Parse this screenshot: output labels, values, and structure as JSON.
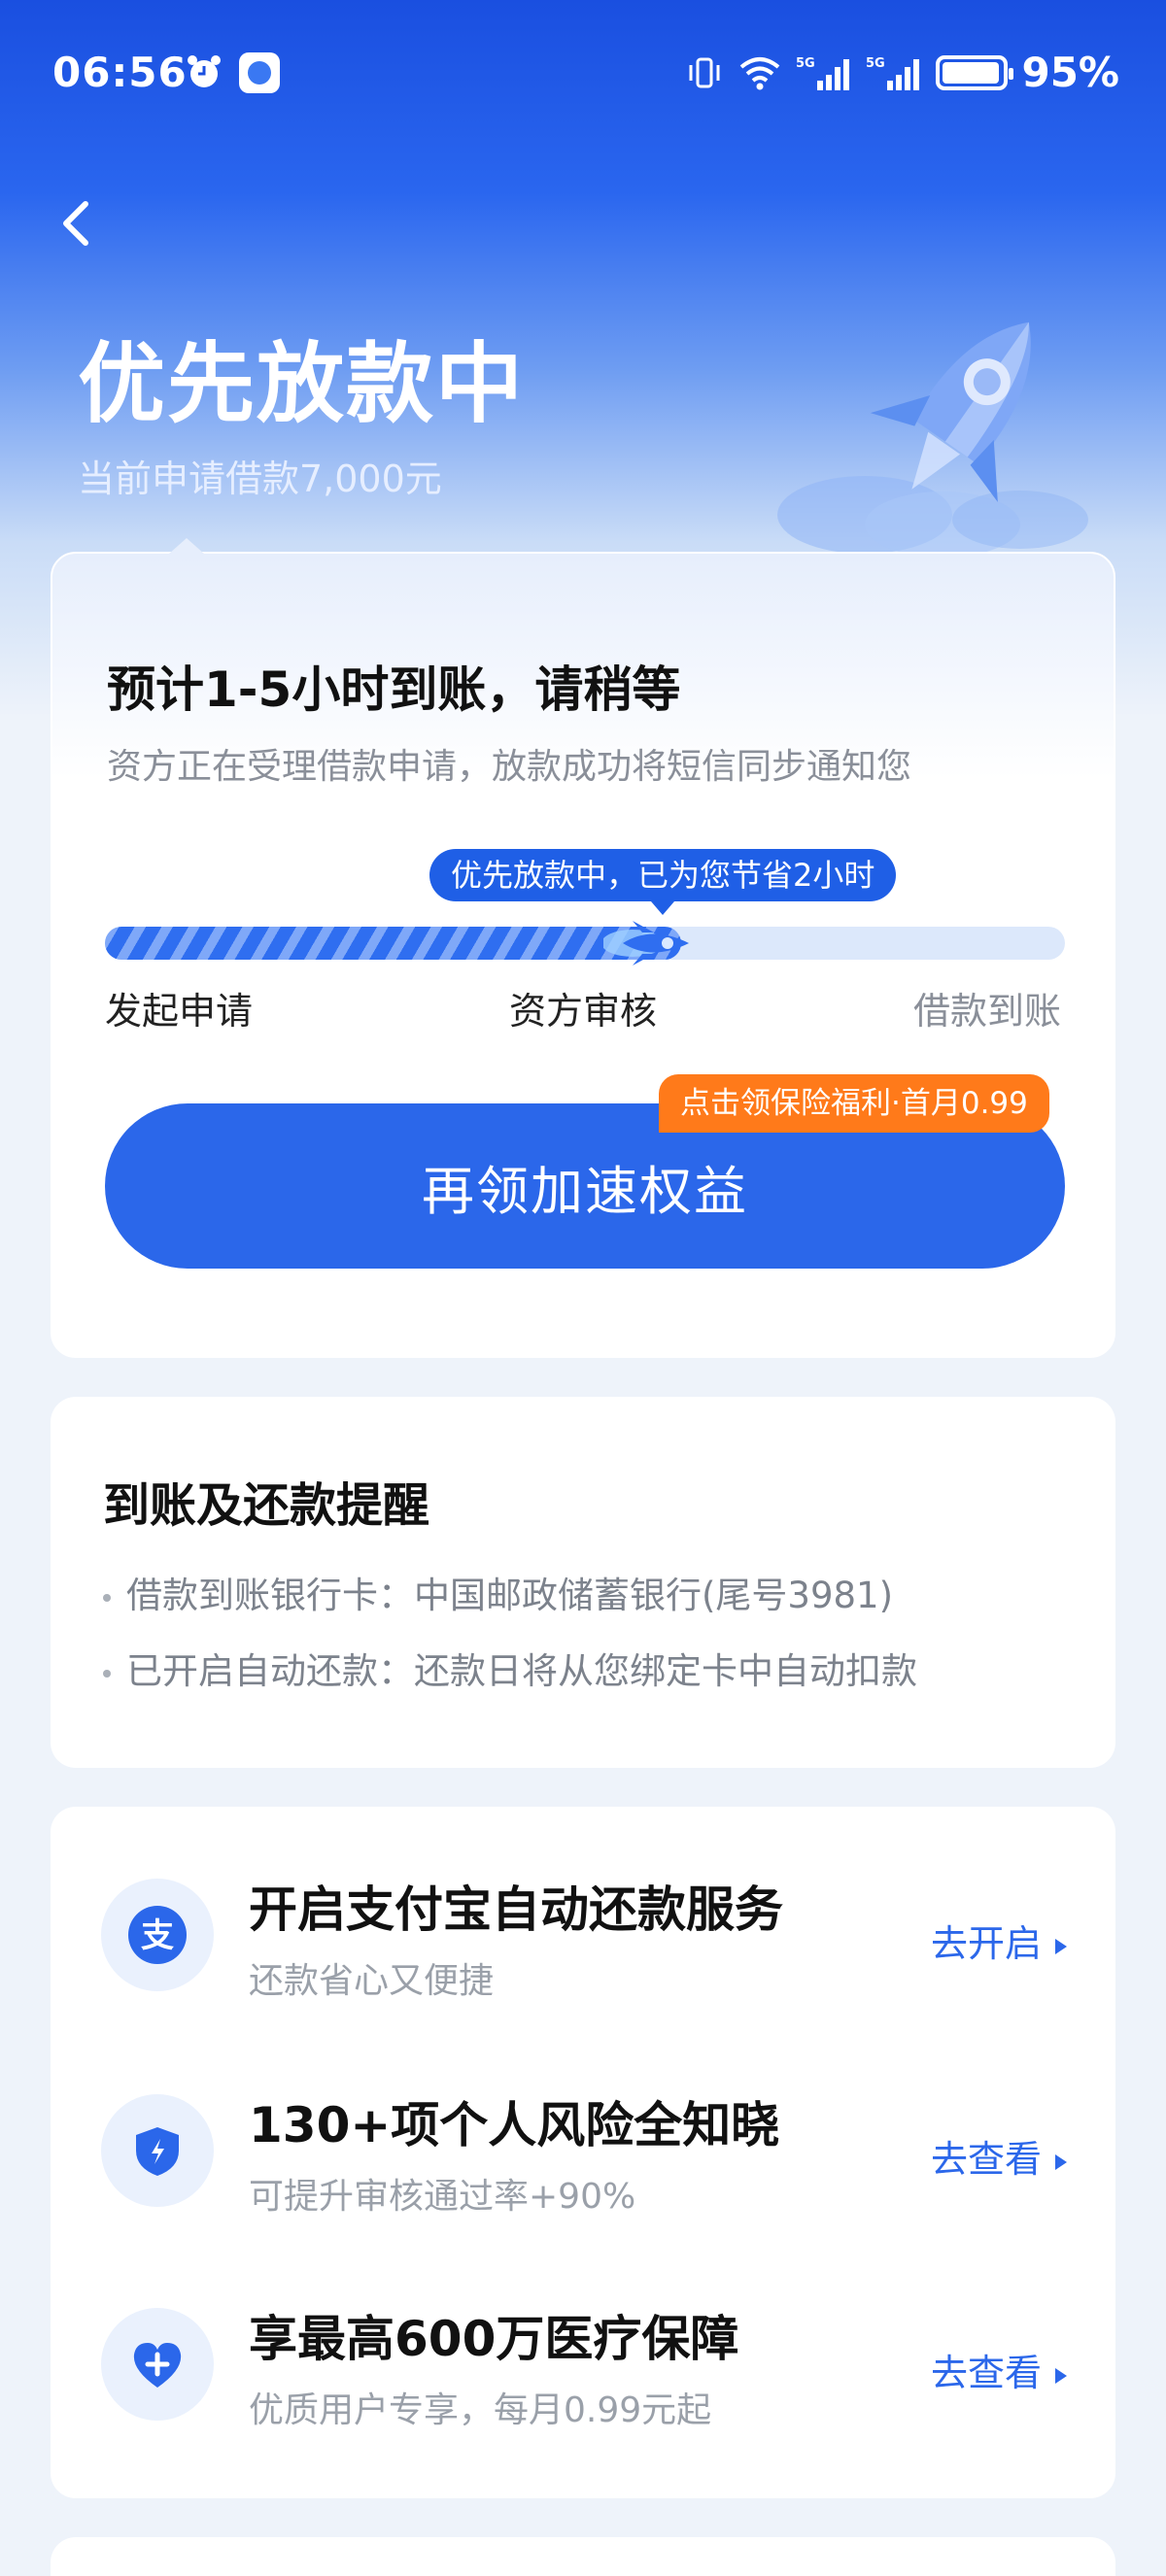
{
  "status_bar": {
    "time": "06:56",
    "battery": "95%",
    "signal_1": "5G",
    "signal_2": "5G"
  },
  "header": {
    "title": "优先放款中",
    "subtitle": "当前申请借款7,000元"
  },
  "status_card": {
    "eta_title": "预计1-5小时到账，请稍等",
    "eta_desc": "资方正在受理借款申请，放款成功将短信同步通知您",
    "speed_tip": "优先放款中，已为您节省2小时",
    "progress": 0.6,
    "steps": [
      "发起申请",
      "资方审核",
      "借款到账"
    ],
    "boost_button": "再领加速权益",
    "boost_badge": "点击领保险福利·首月0.99"
  },
  "reminder": {
    "title": "到账及还款提醒",
    "lines": [
      "借款到账银行卡：中国邮政储蓄银行(尾号3981)",
      "已开启自动还款：还款日将从您绑定卡中自动扣款"
    ]
  },
  "services": [
    {
      "icon": "alipay-icon",
      "title": "开启支付宝自动还款服务",
      "subtitle": "还款省心又便捷",
      "action": "去开启"
    },
    {
      "icon": "shield-icon",
      "title": "130+项个人风险全知晓",
      "subtitle": "可提升审核通过率+90%",
      "action": "去查看"
    },
    {
      "icon": "heart-icon",
      "title": "享最高600万医疗保障",
      "subtitle": "优质用户专享，每月0.99元起",
      "action": "去查看"
    }
  ],
  "colors": {
    "brand": "#2b67ea",
    "badge": "#ff7a1a",
    "hero_top": "#1a4fe0"
  }
}
